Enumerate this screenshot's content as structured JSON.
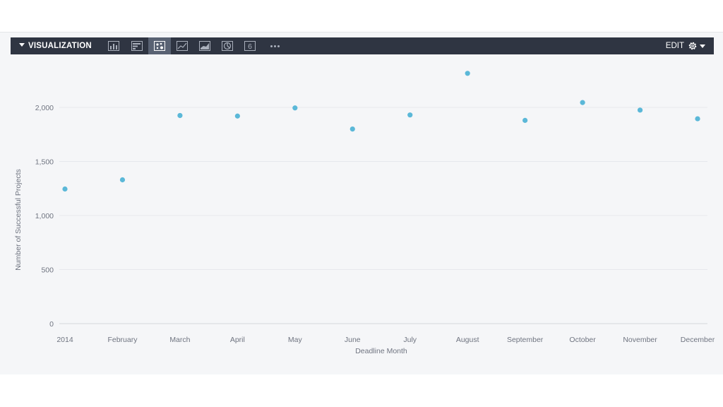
{
  "toolbar": {
    "title": "VISUALIZATION",
    "edit_label": "EDIT",
    "icons": [
      "column-chart-icon",
      "bar-chart-icon",
      "scatter-chart-icon",
      "line-chart-icon",
      "area-chart-icon",
      "pie-chart-icon",
      "single-value-icon",
      "more-icon",
      "gear-icon"
    ],
    "single_value_glyph": "6",
    "active_icon": "scatter-chart-icon"
  },
  "colors": {
    "toolbar_bg": "#2f3542",
    "panel_bg": "#f5f6f8",
    "point": "#5bb8d8"
  },
  "chart_data": {
    "type": "scatter",
    "xlabel": "Deadline Month",
    "ylabel": "Number of Successful Projects",
    "categories": [
      "2014",
      "February",
      "March",
      "April",
      "May",
      "June",
      "July",
      "August",
      "September",
      "October",
      "November",
      "December"
    ],
    "values": [
      1245,
      1330,
      1925,
      1920,
      1995,
      1800,
      1930,
      2315,
      1880,
      2045,
      1975,
      1895
    ],
    "ylim": [
      0,
      2500
    ],
    "yticks": [
      0,
      500,
      1000,
      1500,
      2000
    ],
    "ytick_labels": [
      "0",
      "500",
      "1,000",
      "1,500",
      "2,000"
    ],
    "grid": true
  }
}
